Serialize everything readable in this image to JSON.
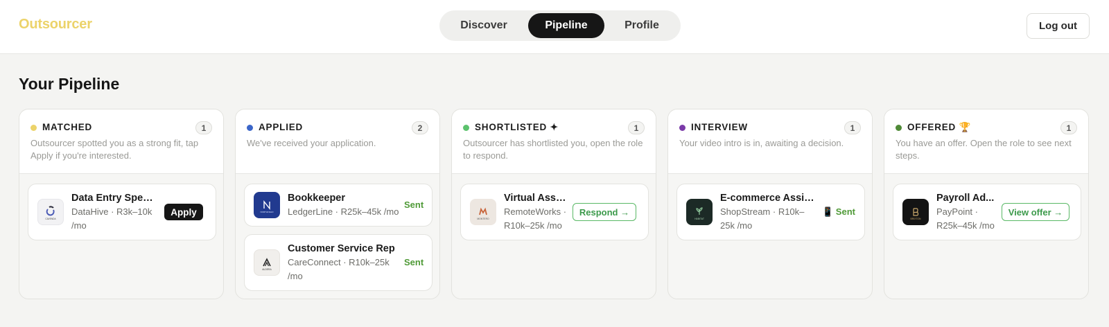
{
  "brand": "Outsourcer",
  "nav": {
    "tabs": [
      "Discover",
      "Pipeline",
      "Profile"
    ],
    "active": "Pipeline"
  },
  "logout_label": "Log out",
  "page_title": "Your Pipeline",
  "colors": {
    "brand": "#ecd36a",
    "matched": "#ecd36a",
    "applied": "#3b66c9",
    "shortlisted": "#5cc26d",
    "interview": "#7a3aa8",
    "offered": "#4f8a37",
    "action_green": "#3c9a4b"
  },
  "columns": [
    {
      "title": "MATCHED",
      "count": "1",
      "description": "Outsourcer spotted you as a strong fit, tap Apply if you're interested.",
      "cards": [
        {
          "title": "Data Entry Speci...",
          "meta": "DataHive · R3k–10k /mo",
          "logo_icon": "datahive-logo",
          "logo_text": "CAVENDA",
          "action": "Apply"
        }
      ]
    },
    {
      "title": "APPLIED",
      "count": "2",
      "description": "We've received your application.",
      "cards": [
        {
          "title": "Bookkeeper",
          "meta": "LedgerLine · R25k–45k /mo",
          "logo_icon": "ledgerline-logo",
          "logo_text": "NORTHFIELD",
          "status": "Sent"
        },
        {
          "title": "Customer Service Rep",
          "meta": "CareConnect · R10k–25k /mo",
          "logo_icon": "careconnect-logo",
          "logo_text": "ALDERA",
          "status": "Sent"
        }
      ]
    },
    {
      "title": "SHORTLISTED ✦",
      "count": "1",
      "description": "Outsourcer has shortlisted you, open the role to respond.",
      "cards": [
        {
          "title": "Virtual Assi...",
          "meta": "RemoteWorks · R10k–25k /mo",
          "logo_icon": "remoteworks-logo",
          "logo_text": "MONTERO",
          "action": "Respond →"
        }
      ]
    },
    {
      "title": "INTERVIEW",
      "count": "1",
      "description": "Your video intro is in, awaiting a decision.",
      "cards": [
        {
          "title": "E-commerce Assist...",
          "meta": "ShopStream · R10k–25k /mo",
          "logo_icon": "shopstream-logo",
          "logo_text": "HABITAT",
          "status": "📱 Sent"
        }
      ]
    },
    {
      "title": "OFFERED 🏆",
      "count": "1",
      "description": "You have an offer. Open the role to see next steps.",
      "cards": [
        {
          "title": "Payroll Ad...",
          "meta": "PayPoint · R25k–45k /mo",
          "logo_icon": "paypoint-logo",
          "logo_text": "BRIXTON",
          "action": "View offer →"
        }
      ]
    }
  ]
}
